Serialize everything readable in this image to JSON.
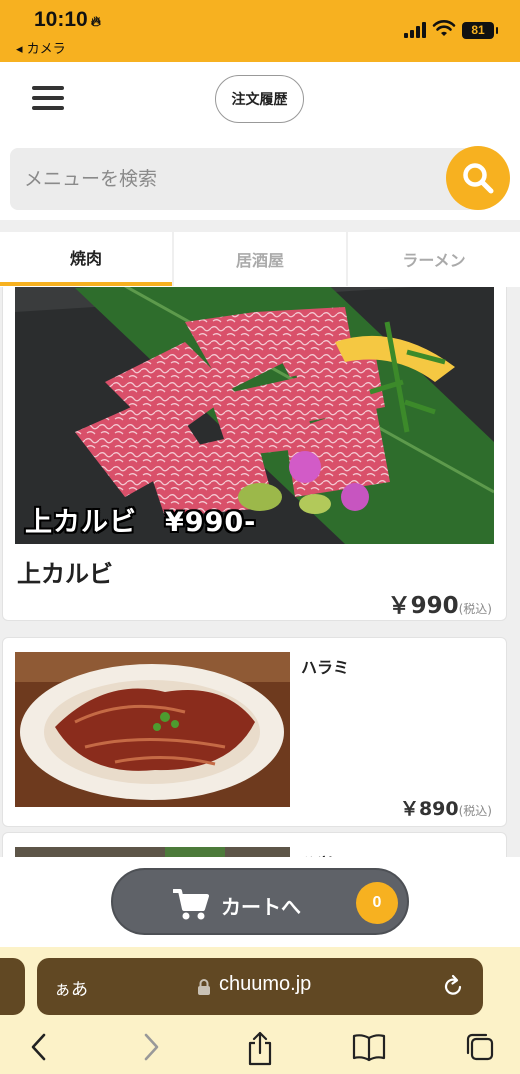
{
  "status_bar": {
    "time": "10:10",
    "back_app": "◂ カメラ",
    "battery": "81"
  },
  "header": {
    "order_history_label": "注文履歴"
  },
  "search": {
    "placeholder": "メニューを検索"
  },
  "tabs": [
    {
      "label": "焼肉",
      "active": true
    },
    {
      "label": "居酒屋",
      "active": false
    },
    {
      "label": "ラーメン",
      "active": false
    }
  ],
  "menu_items": [
    {
      "name": "上カルビ",
      "image_caption": "上カルビ　¥990-",
      "price": "￥990",
      "tax_note": "(税込)"
    },
    {
      "name": "ハラミ",
      "price": "￥890",
      "tax_note": "(税込)"
    },
    {
      "name": "ハツ"
    }
  ],
  "cart": {
    "label": "カートへ",
    "count": "0"
  },
  "browser": {
    "aa_label": "ぁあ",
    "url": "chuumo.jp"
  },
  "colors": {
    "accent": "#f7b120",
    "browser_bar": "#614823",
    "cart_button": "#5f6268"
  }
}
